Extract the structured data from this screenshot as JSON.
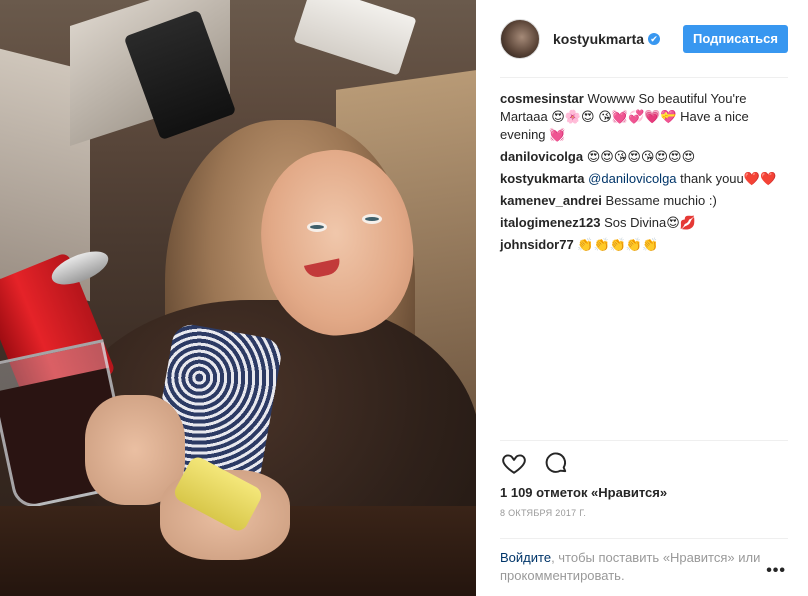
{
  "header": {
    "username": "kostyukmarta",
    "verified_glyph": "✔",
    "follow_label": "Подписаться"
  },
  "comments": [
    {
      "author": "cosmesinstar",
      "text": "Wowww So beautiful You're Martaaa 😍🌸😍 😘💓💞💗💝 Have a nice evening 💓"
    },
    {
      "author": "danilovicolga",
      "text": "😍😍😘😍😘😍😍😍"
    },
    {
      "author": "kostyukmarta",
      "mention": "@danilovicolga",
      "text": "thank youu❤️❤️"
    },
    {
      "author": "kamenev_andrei",
      "text": "Bessame muchio :)"
    },
    {
      "author": "italogimenez123",
      "text": "Sos Divina😍💋"
    },
    {
      "author": "johnsidor77",
      "text": "👏👏👏👏👏"
    }
  ],
  "actions": {
    "like_icon": "heart-outline-icon",
    "comment_icon": "speech-bubble-icon"
  },
  "likes_text": "1 109 отметок «Нравится»",
  "date_text": "8 ОКТЯБРЯ 2017 Г.",
  "login": {
    "link_label": "Войдите",
    "rest_text": ", чтобы поставить «Нравится» или прокомментировать."
  },
  "more_label": "•••",
  "colors": {
    "accent": "#3897f0",
    "link": "#003569",
    "muted": "#999999",
    "text": "#262626"
  }
}
